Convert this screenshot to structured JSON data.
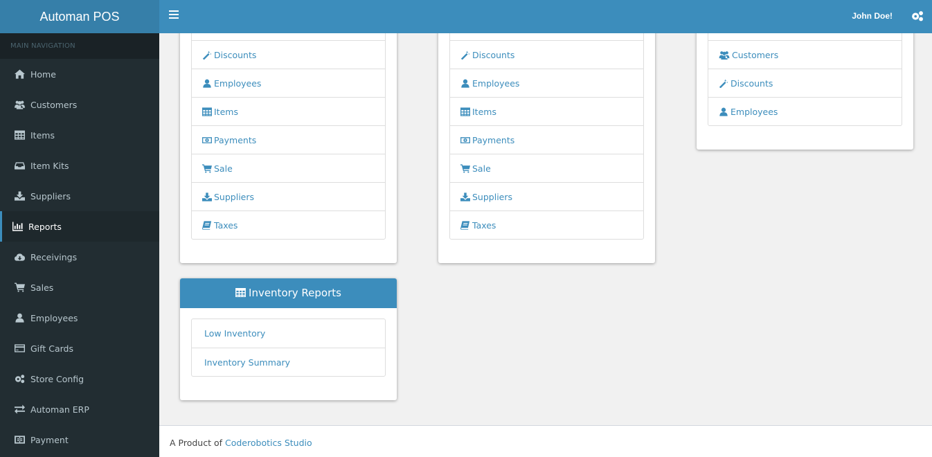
{
  "app": {
    "title": "Automan POS"
  },
  "header": {
    "user_name": "John Doe!",
    "menu_icon": "hamburger-icon",
    "settings_icon": "gears-icon"
  },
  "sidebar": {
    "section_label": "MAIN NAVIGATION",
    "items": [
      {
        "label": "Home",
        "icon": "home-icon"
      },
      {
        "label": "Customers",
        "icon": "users-icon"
      },
      {
        "label": "Items",
        "icon": "table-icon"
      },
      {
        "label": "Item Kits",
        "icon": "inbox-icon"
      },
      {
        "label": "Suppliers",
        "icon": "download-icon"
      },
      {
        "label": "Reports",
        "icon": "bar-chart-icon",
        "active": true
      },
      {
        "label": "Receivings",
        "icon": "cloud-download-icon"
      },
      {
        "label": "Sales",
        "icon": "shopping-cart-icon"
      },
      {
        "label": "Employees",
        "icon": "user-icon"
      },
      {
        "label": "Gift Cards",
        "icon": "credit-card-icon"
      },
      {
        "label": "Store Config",
        "icon": "gears-icon"
      },
      {
        "label": "Automan ERP",
        "icon": "exchange-icon"
      },
      {
        "label": "Payment",
        "icon": "cc-icon"
      }
    ]
  },
  "panels": {
    "left_top": {
      "items": [
        {
          "label": "Discounts",
          "icon": "magic-wand-icon"
        },
        {
          "label": "Employees",
          "icon": "user-icon"
        },
        {
          "label": "Items",
          "icon": "table-icon"
        },
        {
          "label": "Payments",
          "icon": "money-icon"
        },
        {
          "label": "Sale",
          "icon": "shopping-cart-icon"
        },
        {
          "label": "Suppliers",
          "icon": "download-icon"
        },
        {
          "label": "Taxes",
          "icon": "book-icon"
        }
      ]
    },
    "middle_top": {
      "items": [
        {
          "label": "Discounts",
          "icon": "magic-wand-icon"
        },
        {
          "label": "Employees",
          "icon": "user-icon"
        },
        {
          "label": "Items",
          "icon": "table-icon"
        },
        {
          "label": "Payments",
          "icon": "money-icon"
        },
        {
          "label": "Sale",
          "icon": "shopping-cart-icon"
        },
        {
          "label": "Suppliers",
          "icon": "download-icon"
        },
        {
          "label": "Taxes",
          "icon": "book-icon"
        }
      ]
    },
    "right_top": {
      "items": [
        {
          "label": "Customers",
          "icon": "users-icon"
        },
        {
          "label": "Discounts",
          "icon": "magic-wand-icon"
        },
        {
          "label": "Employees",
          "icon": "user-icon"
        }
      ]
    },
    "inventory": {
      "title": "Inventory Reports",
      "icon": "table-icon",
      "items": [
        {
          "label": "Low Inventory"
        },
        {
          "label": "Inventory Summary"
        }
      ]
    }
  },
  "footer": {
    "prefix": "A Product of",
    "link_text": "Coderobotics Studio"
  },
  "colors": {
    "brand": "#3c8dbc",
    "brand_dark": "#367fa9",
    "sidebar_bg": "#222d32",
    "sidebar_text": "#b8c7ce"
  }
}
